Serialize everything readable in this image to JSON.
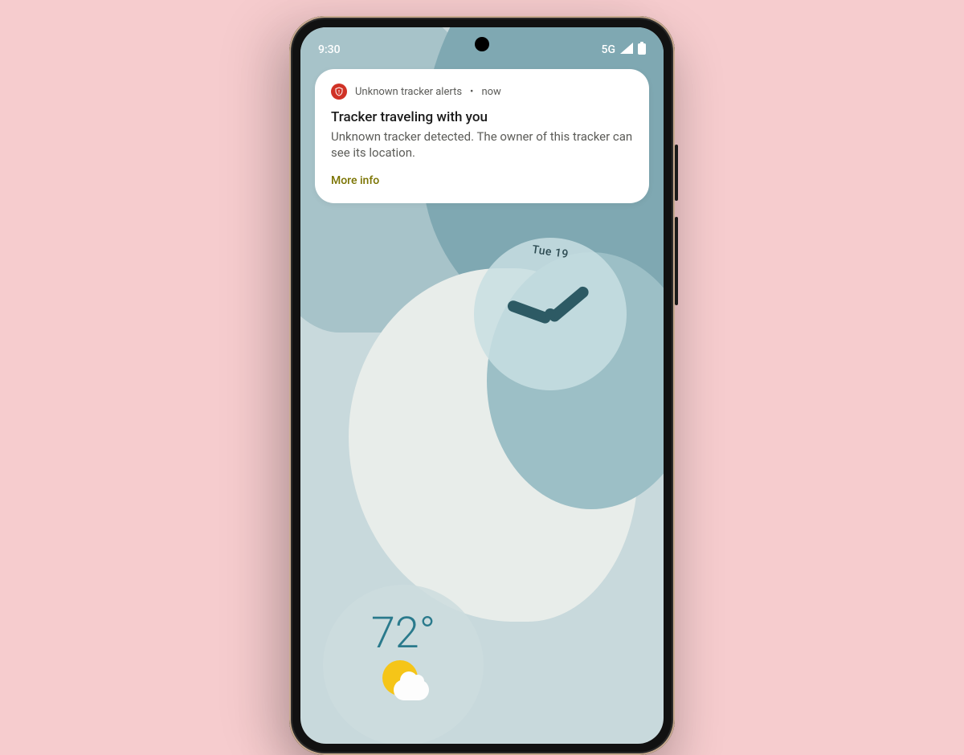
{
  "status": {
    "time": "9:30",
    "network": "5G"
  },
  "notification": {
    "app_name": "Unknown tracker alerts",
    "timestamp": "now",
    "title": "Tracker traveling with you",
    "body": "Unknown tracker detected. The owner of this tracker can see its location.",
    "action": "More info",
    "icon_name": "shield-alert-icon",
    "accent_color": "#d03226"
  },
  "widgets": {
    "clock": {
      "date": "Tue 19"
    },
    "weather": {
      "temp": "72°"
    }
  }
}
